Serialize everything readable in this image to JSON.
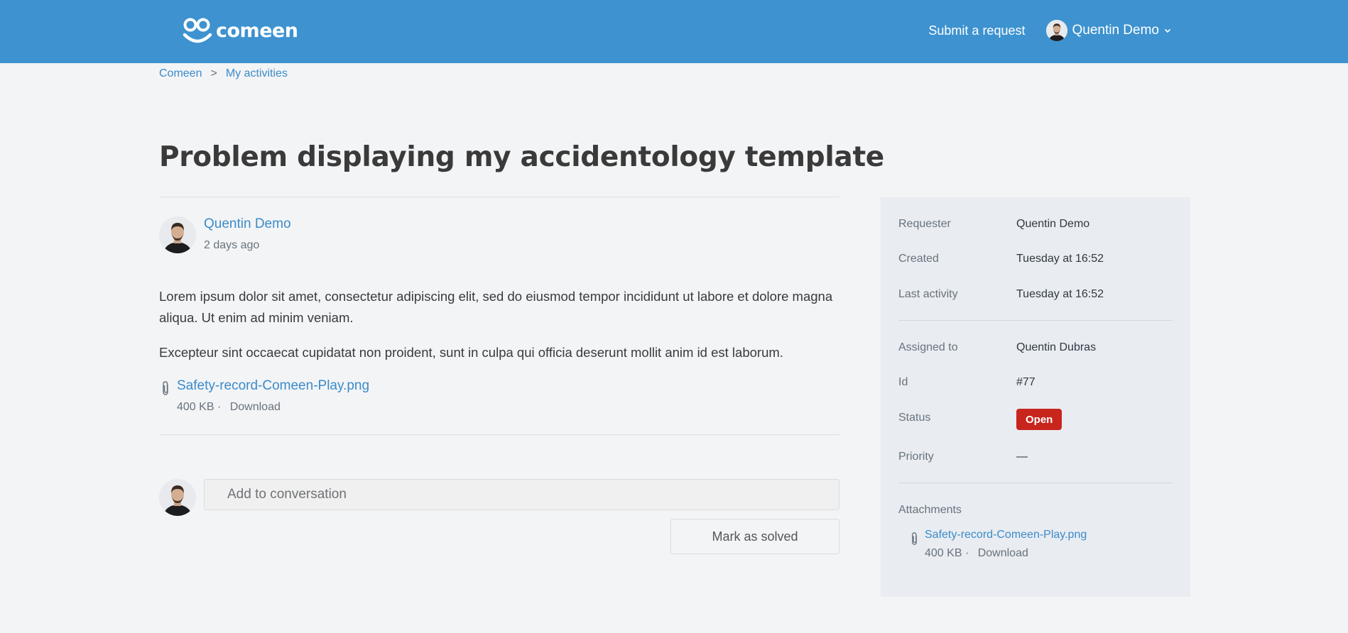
{
  "header": {
    "brand": "comeen",
    "submit_request": "Submit a request",
    "user_name": "Quentin Demo"
  },
  "breadcrumb": {
    "items": [
      "Comeen",
      "My activities"
    ],
    "separator": ">"
  },
  "request": {
    "title": "Problem displaying my accidentology template"
  },
  "comment": {
    "author": "Quentin Demo",
    "time": "2 days ago",
    "paragraphs": [
      "Lorem ipsum dolor sit amet, consectetur adipiscing elit, sed do eiusmod tempor incididunt ut labore et dolore magna aliqua. Ut enim ad minim veniam.",
      "Excepteur sint occaecat cupidatat non proident, sunt in culpa qui officia deserunt mollit anim id est laborum."
    ],
    "attachment": {
      "name": "Safety-record-Comeen-Play.png",
      "size": "400 KB",
      "separator": "·",
      "download": "Download"
    }
  },
  "reply": {
    "placeholder": "Add to conversation",
    "mark_solved": "Mark as solved"
  },
  "sidebar": {
    "requester_label": "Requester",
    "requester_value": "Quentin Demo",
    "created_label": "Created",
    "created_value": "Tuesday at 16:52",
    "last_activity_label": "Last activity",
    "last_activity_value": "Tuesday at 16:52",
    "assigned_label": "Assigned to",
    "assigned_value": "Quentin Dubras",
    "id_label": "Id",
    "id_value": "#77",
    "status_label": "Status",
    "status_value": "Open",
    "priority_label": "Priority",
    "priority_value": "—",
    "attachments_label": "Attachments",
    "attachment": {
      "name": "Safety-record-Comeen-Play.png",
      "size": "400 KB",
      "separator": "·",
      "download": "Download"
    }
  },
  "colors": {
    "header_bg": "#3d92cf",
    "link": "#3b8bc9",
    "status_open": "#c8251d",
    "page_bg": "#f3f4f6",
    "sidebar_bg": "#e9ecf1"
  },
  "icons": [
    "comeen-logo-icon",
    "chevron-down-icon",
    "paperclip-icon",
    "avatar-image"
  ]
}
